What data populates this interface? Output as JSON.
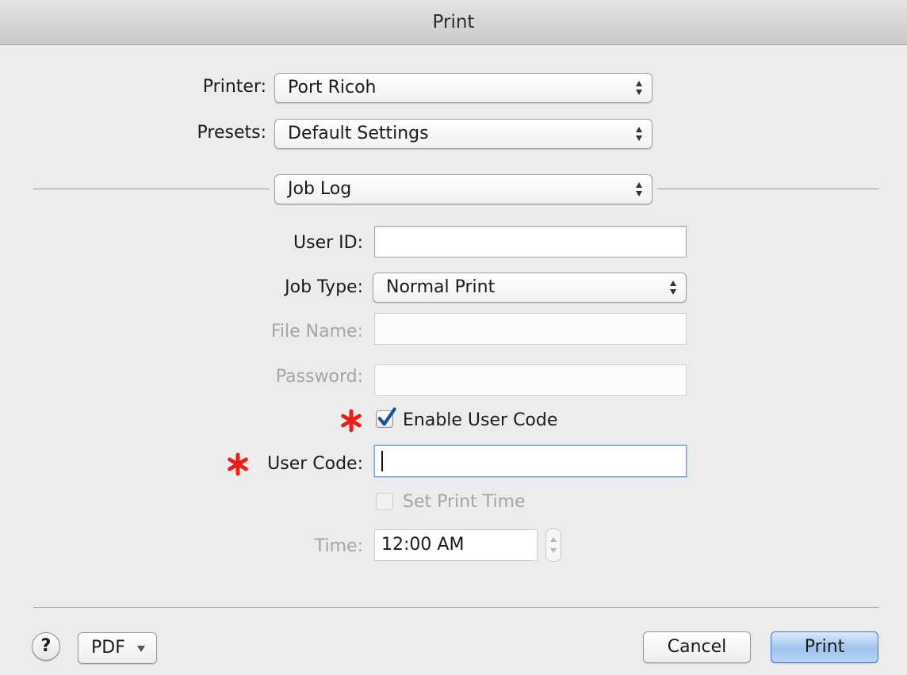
{
  "window": {
    "title": "Print"
  },
  "printer": {
    "label": "Printer:",
    "value": "Port Ricoh"
  },
  "presets": {
    "label": "Presets:",
    "value": "Default Settings"
  },
  "section": {
    "value": "Job Log"
  },
  "user_id": {
    "label": "User ID:",
    "value": ""
  },
  "job_type": {
    "label": "Job Type:",
    "value": "Normal Print"
  },
  "file_name": {
    "label": "File Name:",
    "value": ""
  },
  "password": {
    "label": "Password:",
    "value": ""
  },
  "enable_user_code": {
    "label": "Enable User Code",
    "checked": true
  },
  "user_code": {
    "label": "User Code:",
    "value": ""
  },
  "set_print_time": {
    "label": "Set Print Time",
    "checked": false
  },
  "time": {
    "label": "Time:",
    "value": "12:00 AM"
  },
  "footer": {
    "help_label": "?",
    "pdf_label": "PDF",
    "cancel_label": "Cancel",
    "print_label": "Print"
  },
  "colors": {
    "required_marker": "#e8201c",
    "checkbox_check": "#1b4f9c",
    "default_button": "#9fc3ee"
  },
  "icons": {
    "popup_arrows": "updown-arrows-icon",
    "required": "asterisk-icon",
    "pdf_menu": "triangle-down-icon"
  }
}
